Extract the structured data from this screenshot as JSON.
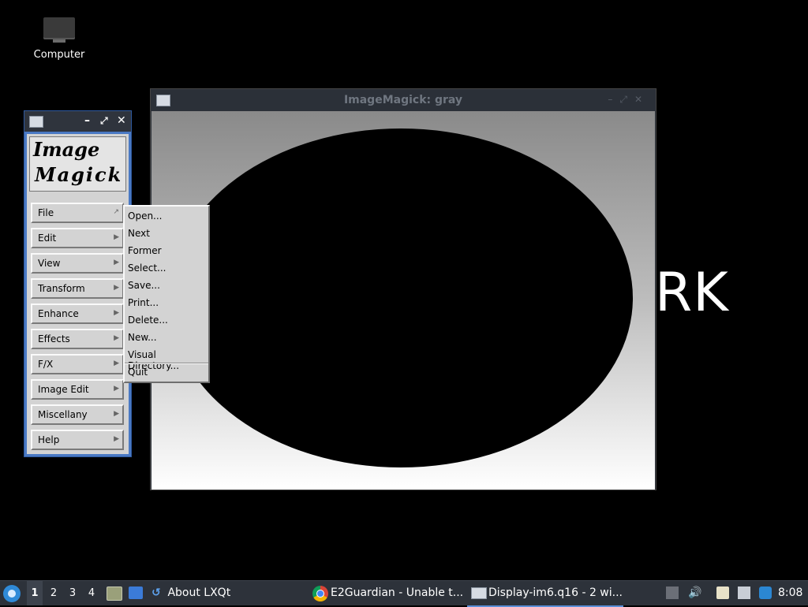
{
  "desktop": {
    "icon_label": "Computer",
    "background_text": "RK"
  },
  "gray_window": {
    "title": "ImageMagick: gray"
  },
  "command_window": {
    "logo_line1": "Image",
    "logo_line2": "Magick",
    "menu": [
      "File",
      "Edit",
      "View",
      "Transform",
      "Enhance",
      "Effects",
      "F/X",
      "Image Edit",
      "Miscellany",
      "Help"
    ]
  },
  "file_menu": {
    "items": [
      "Open...",
      "Next",
      "Former",
      "Select...",
      "Save...",
      "Print...",
      "Delete...",
      "New...",
      "Visual Directory...",
      "Quit"
    ]
  },
  "taskbar": {
    "desktops": [
      "1",
      "2",
      "3",
      "4"
    ],
    "active_desktop": "1",
    "tasks": [
      {
        "label": "About LXQt",
        "icon": "lxqt-icon"
      },
      {
        "label": "E2Guardian - Unable t...",
        "icon": "chrome-icon"
      },
      {
        "label": "Display-im6.q16 - 2 wi...",
        "icon": "window-icon",
        "active": true
      }
    ],
    "clock": "8:08"
  },
  "colors": {
    "taskbar_bg": "#2d323a",
    "cmd_window_border": "#4a79c4",
    "accent": "#5b8fd8"
  }
}
